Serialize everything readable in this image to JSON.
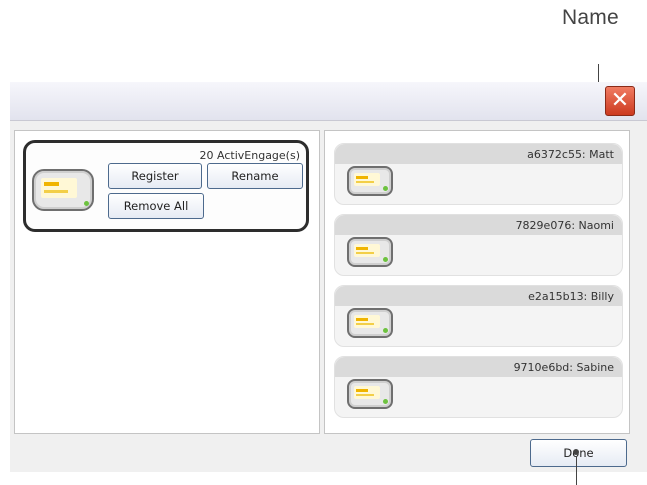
{
  "callout": {
    "name_label": "Name"
  },
  "window": {
    "close_symbol": "✕"
  },
  "group": {
    "count_label": "20 ActivEngage(s)",
    "buttons": {
      "register": "Register",
      "rename": "Rename",
      "remove_all": "Remove All"
    }
  },
  "devices": [
    {
      "label": "a6372c55: Matt"
    },
    {
      "label": "7829e076: Naomi"
    },
    {
      "label": "e2a15b13: Billy"
    },
    {
      "label": "9710e6bd: Sabine"
    }
  ],
  "footer": {
    "done_label": "Done"
  },
  "colors": {
    "close_button": "#cc3a20",
    "button_border": "#4d6a8d",
    "device_status": "#6dc23f",
    "screen_highlight": "#f0b400"
  },
  "icons": {
    "close": "close-icon",
    "device": "activengage-device-icon"
  }
}
